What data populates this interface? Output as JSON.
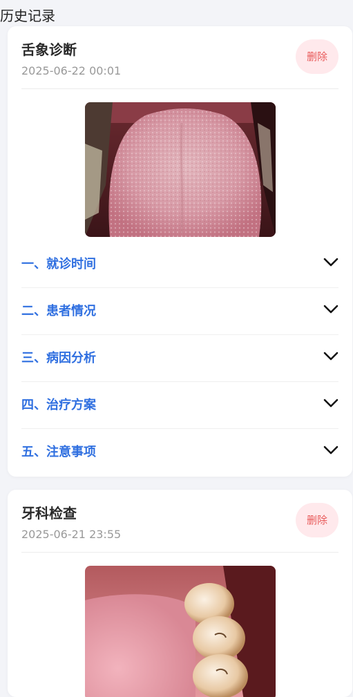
{
  "page": {
    "title": "历史记录"
  },
  "records": [
    {
      "title": "舌象诊断",
      "time": "2025-06-22 00:01",
      "delete_label": "删除",
      "image": "tongue-photo",
      "sections": [
        {
          "label": "一、就诊时间"
        },
        {
          "label": "二、患者情况"
        },
        {
          "label": "三、病因分析"
        },
        {
          "label": "四、治疗方案"
        },
        {
          "label": "五、注意事项"
        }
      ]
    },
    {
      "title": "牙科检查",
      "time": "2025-06-21 23:55",
      "delete_label": "删除",
      "image": "teeth-photo"
    }
  ],
  "colors": {
    "background": "#f3f4f8",
    "accent": "#2f6fe0",
    "delete_text": "#e85a5a",
    "delete_bg": "#ffe9ec"
  },
  "icons": {
    "expand": "chevron-down-icon"
  }
}
